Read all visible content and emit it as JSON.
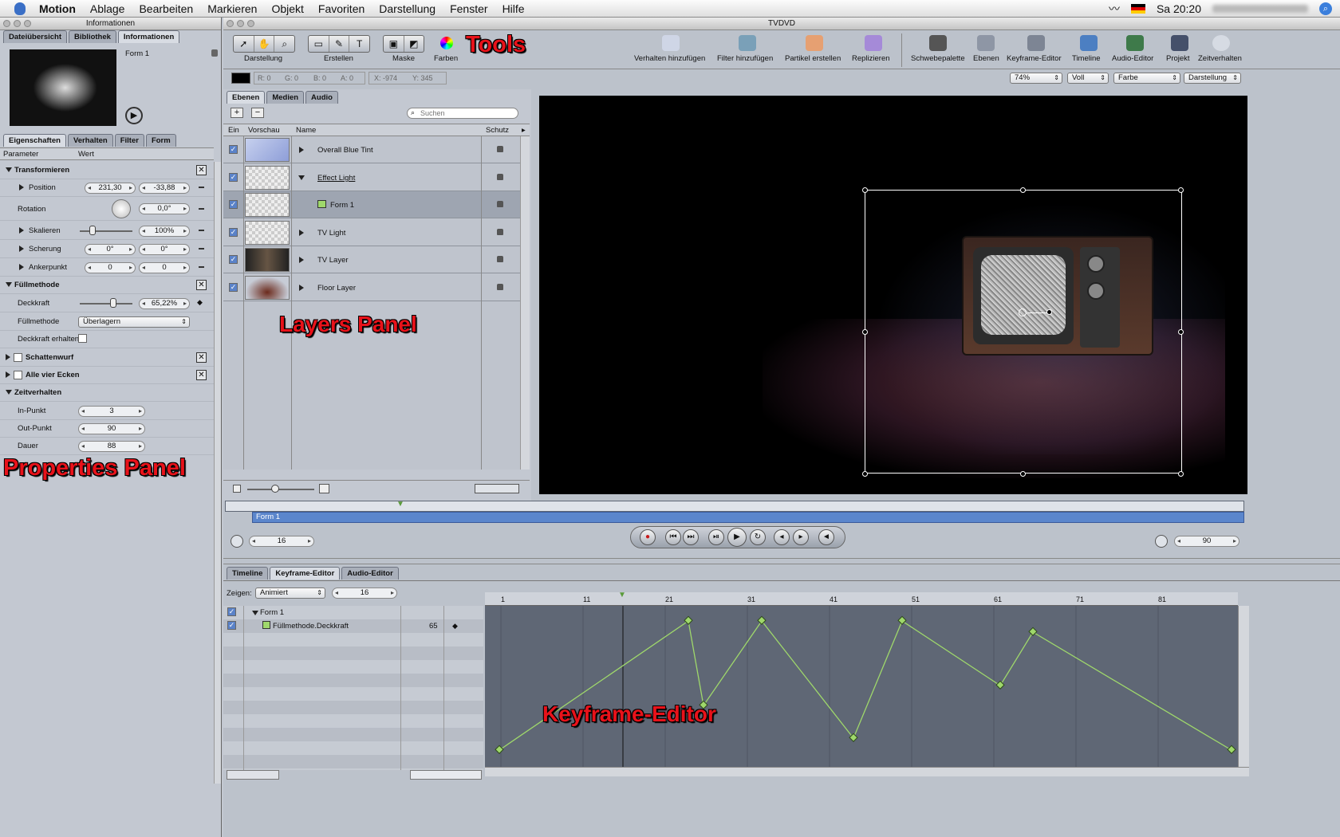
{
  "menubar": {
    "app": "Motion",
    "items": [
      "Ablage",
      "Bearbeiten",
      "Markieren",
      "Objekt",
      "Favoriten",
      "Darstellung",
      "Fenster",
      "Hilfe"
    ],
    "clock": "Sa 20:20"
  },
  "inspector": {
    "title": "Informationen",
    "top_tabs": [
      "Dateiübersicht",
      "Bibliothek",
      "Informationen"
    ],
    "object_name": "Form 1",
    "sub_tabs": [
      "Eigenschaften",
      "Verhalten",
      "Filter",
      "Form"
    ],
    "col_param": "Parameter",
    "col_value": "Wert",
    "rows": {
      "transform": "Transformieren",
      "position": "Position",
      "pos_x": "231,30",
      "pos_y": "-33,88",
      "rotation": "Rotation",
      "rot_val": "0,0°",
      "scale": "Skalieren",
      "scale_val": "100%",
      "shear": "Scherung",
      "shear_x": "0°",
      "shear_y": "0°",
      "anchor": "Ankerpunkt",
      "anchor_x": "0",
      "anchor_y": "0",
      "blend": "Füllmethode",
      "opacity": "Deckkraft",
      "opacity_val": "65,22%",
      "blendmode": "Füllmethode",
      "blendmode_val": "Überlagern",
      "keep_opacity": "Deckkraft erhalten",
      "shadow": "Schattenwurf",
      "corners": "Alle vier Ecken",
      "timing": "Zeitverhalten",
      "in_point": "In-Punkt",
      "in_val": "3",
      "out_point": "Out-Punkt",
      "out_val": "90",
      "duration": "Dauer",
      "dur_val": "88"
    }
  },
  "window": {
    "title": "TVDVD"
  },
  "toolbar": {
    "groups": [
      "Darstellung",
      "Erstellen",
      "Maske",
      "Farben"
    ],
    "right": [
      "Verhalten hinzufügen",
      "Filter hinzufügen",
      "Partikel erstellen",
      "Replizieren",
      "Schwebepalette",
      "Ebenen",
      "Keyframe-Editor",
      "Timeline",
      "Audio-Editor",
      "Projekt",
      "Zeitverhalten"
    ]
  },
  "colorbar": {
    "r": "R: 0",
    "g": "G: 0",
    "b": "B: 0",
    "a": "A: 0",
    "x": "X: -974",
    "y": "Y: 345"
  },
  "view_popups": [
    "74%",
    "Voll",
    "Farbe",
    "Darstellung"
  ],
  "layers": {
    "tabs": [
      "Ebenen",
      "Medien",
      "Audio"
    ],
    "search_placeholder": "Suchen",
    "headers": [
      "Ein",
      "Vorschau",
      "Name",
      "Schutz"
    ],
    "items": [
      "Overall Blue Tint",
      "Effect Light",
      "Form 1",
      "TV Light",
      "TV Layer",
      "Floor Layer"
    ]
  },
  "timebar": {
    "label": "Form 1",
    "current_frame": "16",
    "end_frame": "90"
  },
  "keyframe": {
    "tabs": [
      "Timeline",
      "Keyframe-Editor",
      "Audio-Editor"
    ],
    "show_label": "Zeigen:",
    "show_val": "Animiert",
    "frame": "16",
    "obj": "Form 1",
    "param": "Füllmethode.Deckkraft",
    "param_val": "65",
    "ruler": [
      "1",
      "11",
      "21",
      "31",
      "41",
      "51",
      "61",
      "71",
      "81"
    ]
  },
  "annotations": {
    "tools": "Tools",
    "layers": "Layers Panel",
    "properties": "Properties Panel",
    "keyframe": "Keyframe-Editor"
  },
  "colors": {
    "annotation": "#e8121a",
    "curve": "#9fd86b",
    "canvas": "#000000"
  }
}
